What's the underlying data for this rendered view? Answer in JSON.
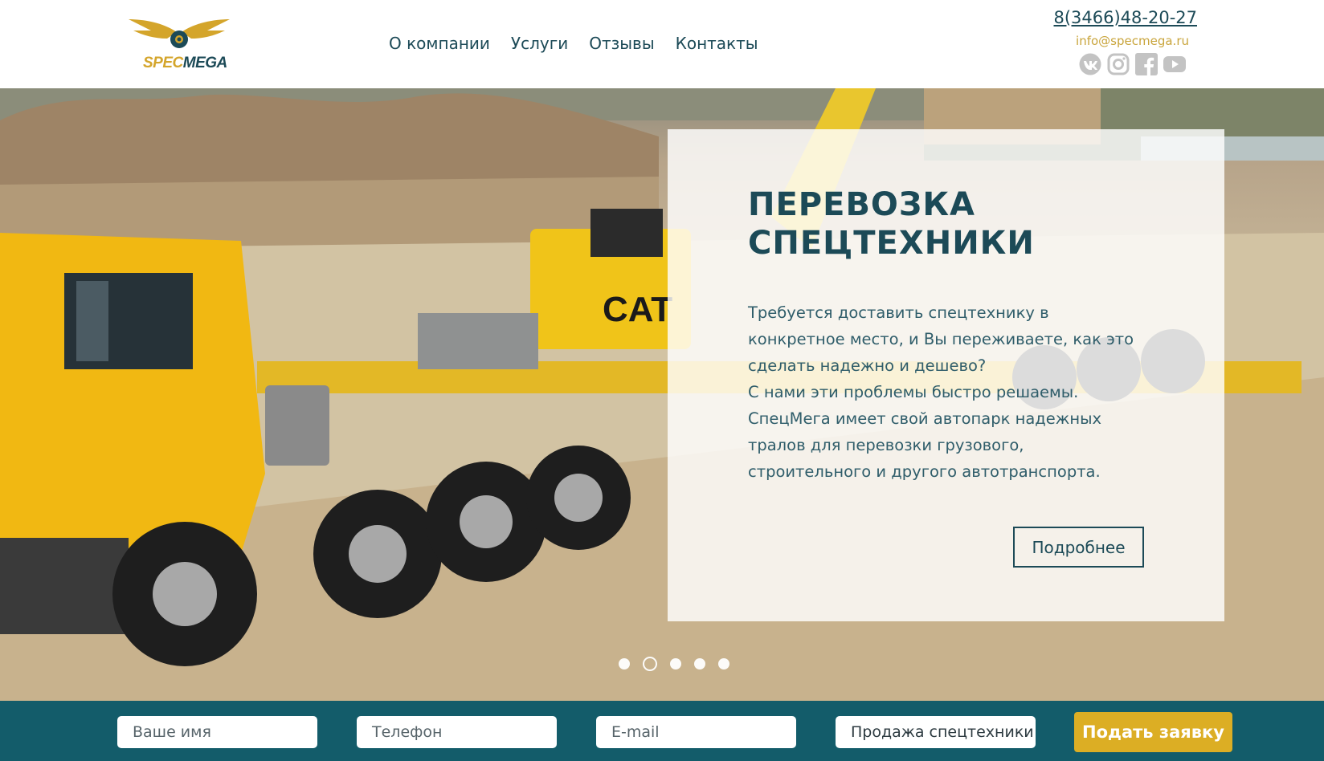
{
  "header": {
    "logo": {
      "part1": "SPEC",
      "part2": "MEGA"
    },
    "nav": [
      "О компании",
      "Услуги",
      "Отзывы",
      "Контакты"
    ],
    "phone": "8(3466)48-20-27",
    "email": "info@specmega.ru",
    "socials": [
      "vk-icon",
      "instagram-icon",
      "facebook-icon",
      "youtube-icon"
    ]
  },
  "hero": {
    "title": "ПЕРЕВОЗКА СПЕЦТЕХНИКИ",
    "text": "Требуется доставить спецтехнику в конкретное место, и Вы переживаете, как это сделать надежно и дешево?\nС нами эти проблемы быстро решаемы. СпецМега имеет свой автопарк надежных тралов для перевозки грузового, строительного и другого автотранспорта.",
    "button": "Подробнее",
    "slides_total": 5,
    "active_slide": 2
  },
  "form": {
    "name_placeholder": "Ваше имя",
    "phone_placeholder": "Телефон",
    "email_placeholder": "E-mail",
    "service_value": "Продажа спецтехники",
    "submit": "Подать заявку"
  },
  "colors": {
    "primary": "#1c4a57",
    "accent": "#dcae24",
    "formbar": "#135c6a",
    "social_grey": "#c3c3c3"
  }
}
